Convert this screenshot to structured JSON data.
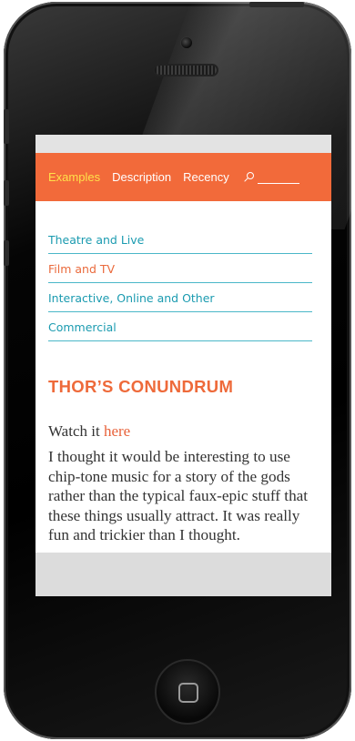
{
  "navbar": {
    "items": [
      {
        "label": "Examples",
        "active": true
      },
      {
        "label": "Description",
        "active": false
      },
      {
        "label": "Recency",
        "active": false
      }
    ],
    "search": {
      "icon": "search-icon",
      "value": ""
    }
  },
  "categories": [
    {
      "label": "Theatre and Live",
      "current": false
    },
    {
      "label": "Film and TV",
      "current": true
    },
    {
      "label": "Interactive, Online and Other",
      "current": false
    },
    {
      "label": "Commercial",
      "current": false
    }
  ],
  "post": {
    "title": "THOR’S CONUNDRUM",
    "watch_prefix": "Watch it ",
    "watch_link": "here",
    "body": "I thought it would be interesting to use chip-tone music for a story of the gods rather than the typical faux-epic stuff that these things usually attract. It was really fun and trickier than I thought."
  },
  "colors": {
    "accent": "#f26a3a",
    "active_nav": "#ffe14a",
    "link_teal": "#1b9bb0",
    "link_orange": "#e8623a"
  },
  "device": {
    "home_button_icon": "home-square-icon"
  }
}
